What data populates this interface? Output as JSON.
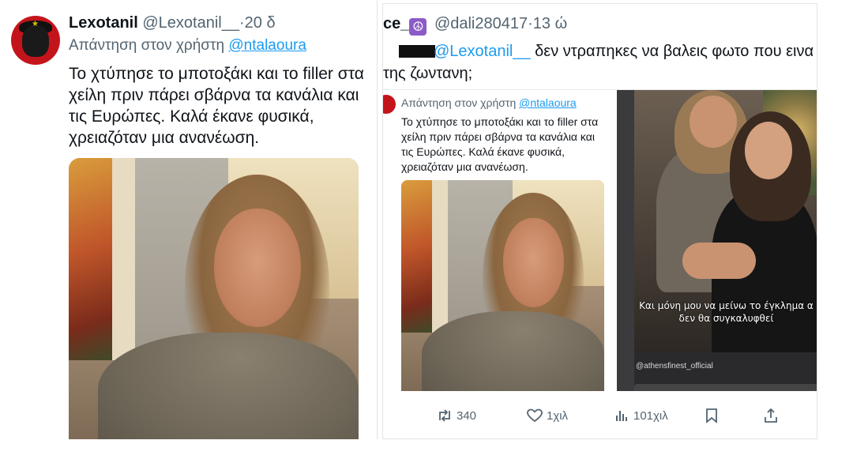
{
  "left_tweet": {
    "display_name": "Lexotanil",
    "handle": "@Lexotanil__",
    "separator": "·",
    "time": "20 δ",
    "reply_prefix": "Απάντηση στον χρήστη",
    "reply_to": "@ntalaoura",
    "text": "Το χτύπησε το μποτοξάκι και το filler στα χείλη πριν πάρει σβάρνα τα κανάλια και τις Ευρώπες. Καλά έκανε φυσικά, χρειαζόταν μια ανανέωση."
  },
  "right_tweet": {
    "name_fragment": "ce_",
    "peace_symbol": "☮",
    "handle": "@dali280417",
    "separator": "·",
    "time": "13 ώ",
    "mention": "@Lexotanil__",
    "text_line1": "δεν ντραπηκες να βαλεις φωτο που εινα",
    "text_line2": "της ζωντανη;",
    "embedded": {
      "reply_prefix": "Απάντηση στον χρήστη",
      "reply_to": "@ntalaoura",
      "text": "Το χτύπησε το μποτοξάκι και το filler στα χείλη πριν πάρει σβάρνα τα κανάλια και τις Ευρώπες. Καλά έκανε φυσικά, χρειαζόταν μια ανανέωση.",
      "caption_line1": "Και μόνη μου να μείνω το έγκλημα α",
      "caption_line2": "δεν θα συγκαλυφθεί",
      "credit": "@athensfinest_official"
    },
    "actions": {
      "retweets": "340",
      "likes": "1χιλ",
      "views": "101χιλ"
    }
  },
  "icons": [
    "retweet-icon",
    "heart-icon",
    "views-icon",
    "bookmark-icon",
    "share-icon",
    "peace-icon"
  ],
  "colors": {
    "link": "#1d9bf0",
    "text": "#0f1419",
    "muted": "#536471"
  }
}
